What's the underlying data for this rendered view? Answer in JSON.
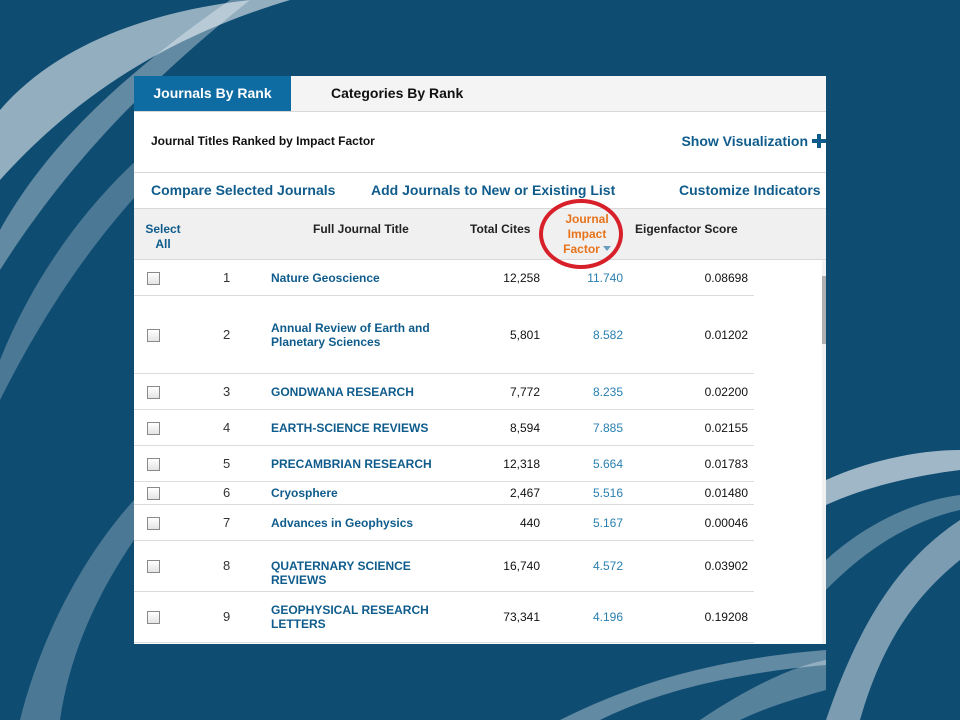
{
  "tabs": [
    {
      "label": "Journals By Rank",
      "active": true
    },
    {
      "label": "Categories By Rank",
      "active": false
    }
  ],
  "subtitle": "Journal Titles Ranked by Impact Factor",
  "show_visualization": "Show Visualization",
  "actions": {
    "compare": "Compare Selected Journals",
    "add": "Add Journals to New or Existing List",
    "customize": "Customize Indicators"
  },
  "columns": {
    "select_all_line1": "Select",
    "select_all_line2": "All",
    "title": "Full Journal Title",
    "cites": "Total Cites",
    "jif_line1": "Journal",
    "jif_line2": "Impact",
    "jif_line3": "Factor",
    "eigen": "Eigenfactor Score"
  },
  "rows": [
    {
      "rank": "1",
      "title": "Nature Geoscience",
      "cites": "12,258",
      "jif": "11.740",
      "eigen": "0.08698"
    },
    {
      "rank": "2",
      "title": "Annual Review of Earth and Planetary Sciences",
      "cites": "5,801",
      "jif": "8.582",
      "eigen": "0.01202"
    },
    {
      "rank": "3",
      "title": "GONDWANA RESEARCH",
      "cites": "7,772",
      "jif": "8.235",
      "eigen": "0.02200"
    },
    {
      "rank": "4",
      "title": "EARTH-SCIENCE REVIEWS",
      "cites": "8,594",
      "jif": "7.885",
      "eigen": "0.02155"
    },
    {
      "rank": "5",
      "title": "PRECAMBRIAN RESEARCH",
      "cites": "12,318",
      "jif": "5.664",
      "eigen": "0.01783"
    },
    {
      "rank": "6",
      "title": "Cryosphere",
      "cites": "2,467",
      "jif": "5.516",
      "eigen": "0.01480"
    },
    {
      "rank": "7",
      "title": "Advances in Geophysics",
      "cites": "440",
      "jif": "5.167",
      "eigen": "0.00046"
    },
    {
      "rank": "8",
      "title": "QUATERNARY SCIENCE REVIEWS",
      "cites": "16,740",
      "jif": "4.572",
      "eigen": "0.03902"
    },
    {
      "rank": "9",
      "title": "GEOPHYSICAL RESEARCH LETTERS",
      "cites": "73,341",
      "jif": "4.196",
      "eigen": "0.19208"
    }
  ],
  "colors": {
    "background": "#0f4c72",
    "tab_active": "#0f6ca3",
    "link": "#0f5c8c",
    "jif_header": "#e8731a",
    "highlight_circle": "#d8202a"
  }
}
